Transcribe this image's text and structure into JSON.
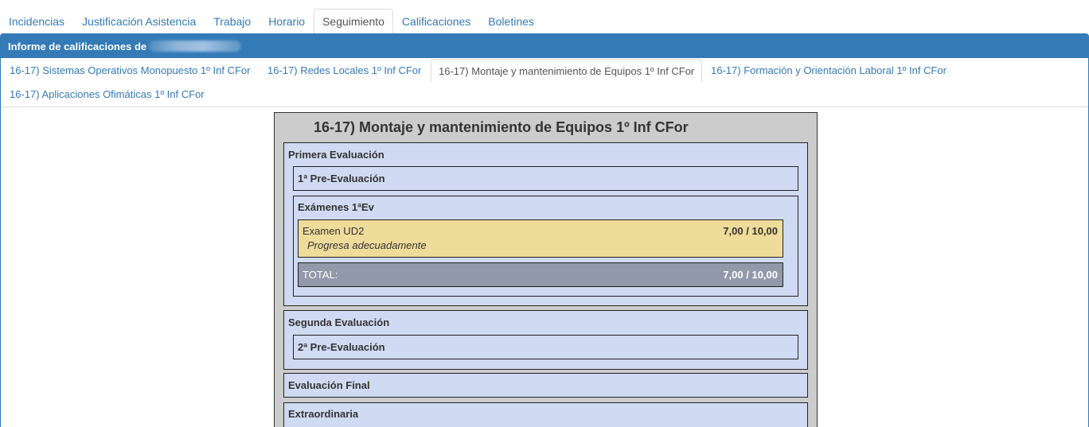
{
  "top_tabs": [
    {
      "label": "Incidencias",
      "active": false
    },
    {
      "label": "Justificación Asistencia",
      "active": false
    },
    {
      "label": "Trabajo",
      "active": false
    },
    {
      "label": "Horario",
      "active": false
    },
    {
      "label": "Seguimiento",
      "active": true
    },
    {
      "label": "Calificaciones",
      "active": false
    },
    {
      "label": "Boletines",
      "active": false
    }
  ],
  "panel": {
    "heading": "Informe de calificaciones de"
  },
  "subject_tabs": [
    {
      "label": "16-17) Sistemas Operativos Monopuesto 1º Inf CFor",
      "active": false
    },
    {
      "label": "16-17) Redes Locales 1º Inf CFor",
      "active": false
    },
    {
      "label": "16-17) Montaje y mantenimiento de Equipos 1º Inf CFor",
      "active": true
    },
    {
      "label": "16-17) Formación y Orientación Laboral 1º Inf CFor",
      "active": false
    },
    {
      "label": "16-17) Aplicaciones Ofimáticas 1º Inf CFor",
      "active": false
    }
  ],
  "report": {
    "title": "16-17) Montaje y mantenimiento de Equipos 1º Inf CFor",
    "evaluations": [
      {
        "title": "Primera Evaluación",
        "groups": [
          {
            "title": "1ª Pre-Evaluación"
          },
          {
            "title": "Exámenes 1ªEv",
            "item": {
              "name": "Examen UD2",
              "score": "7,00 / 10,00",
              "comment": "Progresa adecuadamente"
            },
            "total": {
              "label": "TOTAL:",
              "score": "7,00 / 10,00"
            }
          }
        ]
      },
      {
        "title": "Segunda Evaluación",
        "groups": [
          {
            "title": "2ª Pre-Evaluación"
          }
        ]
      },
      {
        "title": "Evaluación Final"
      },
      {
        "title": "Extraordinaria"
      }
    ]
  },
  "colors": {
    "brand": "#337ab7",
    "report_bg": "#cccccc",
    "evaluation_bg": "#d0daf2",
    "item_bg": "#eedc9a",
    "total_bg": "#9199aa"
  }
}
